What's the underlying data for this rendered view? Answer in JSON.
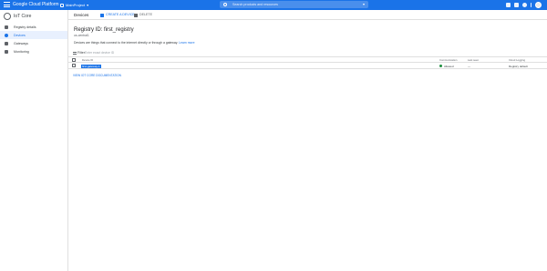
{
  "topbar": {
    "brand": "Google Cloud Platform",
    "project": "MainProject",
    "search_placeholder": "Search products and resources",
    "icons": [
      "apps-icon",
      "notifications-icon",
      "help-icon",
      "more-icon"
    ]
  },
  "sidebar": {
    "title": "IoT Core",
    "items": [
      {
        "label": "Registry details",
        "icon": "details-icon",
        "active": false
      },
      {
        "label": "Devices",
        "icon": "devices-icon",
        "active": true
      },
      {
        "label": "Gateways",
        "icon": "gateways-icon",
        "active": false
      },
      {
        "label": "Monitoring",
        "icon": "monitoring-icon",
        "active": false
      }
    ]
  },
  "actionbar": {
    "title": "Devices",
    "create_label": "CREATE A DEVICE",
    "delete_label": "DELETE"
  },
  "main": {
    "registry_title": "Registry ID: first_registry",
    "region": "us-central1",
    "description": "Devices are things that connect to the internet directly or through a gateway.",
    "learn_more": "Learn more",
    "filter_label": "Filter",
    "filter_placeholder": "Enter exact device ID",
    "columns": {
      "device_id": "Device ID",
      "communication": "Communication",
      "last_seen": "Last seen",
      "stackdriver": "Cloud Logging"
    },
    "rows": [
      {
        "device_id": "first-gateway-1",
        "communication": "Allowed",
        "last_seen": "—",
        "stackdriver": "Registry default"
      }
    ],
    "doc_link": "VIEW IOT CORE DOCUMENTATION"
  },
  "colors": {
    "accent": "#1a73e8",
    "allowed": "#1e8e3e"
  }
}
